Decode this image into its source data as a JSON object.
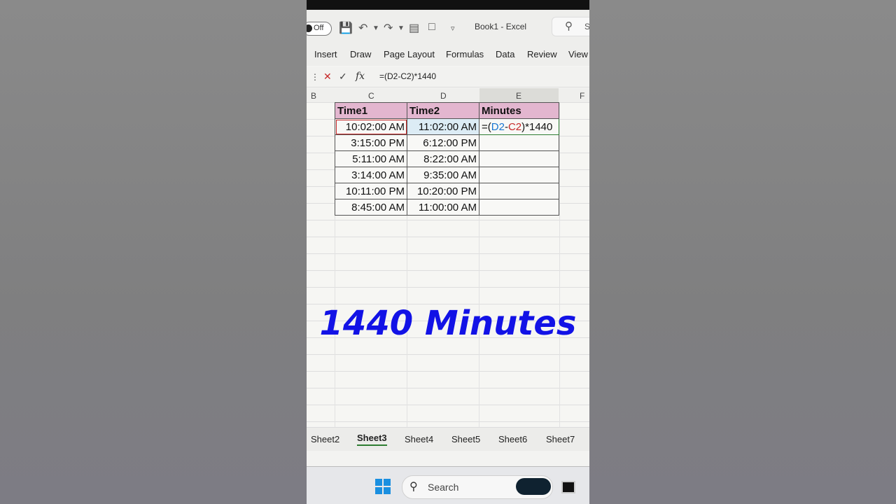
{
  "window": {
    "title": "Book1  -  Excel",
    "autosave_label": "Off",
    "search_label": "S"
  },
  "ribbon": {
    "tabs": [
      "Insert",
      "Draw",
      "Page Layout",
      "Formulas",
      "Data",
      "Review",
      "View"
    ]
  },
  "formula_bar": {
    "fx": "fx",
    "formula": "=(D2-C2)*1440"
  },
  "columns": [
    "B",
    "C",
    "D",
    "E",
    "F"
  ],
  "table": {
    "headers": [
      "Time1",
      "Time2",
      "Minutes"
    ],
    "rows": [
      [
        "10:02:00 AM",
        "11:02:00 AM",
        ""
      ],
      [
        "3:15:00 PM",
        "6:12:00 PM",
        ""
      ],
      [
        "5:11:00 AM",
        "8:22:00 AM",
        ""
      ],
      [
        "3:14:00 AM",
        "9:35:00 AM",
        ""
      ],
      [
        "10:11:00 PM",
        "10:20:00 PM",
        ""
      ],
      [
        "8:45:00 AM",
        "11:00:00 AM",
        ""
      ]
    ],
    "active_cell": {
      "prefix": "=(",
      "ref1": "D2",
      "sep": "-",
      "ref2": "C2",
      "suffix": ")*1440"
    }
  },
  "overlay_text": "1440 Minutes",
  "sheets": {
    "tabs": [
      "Sheet2",
      "Sheet3",
      "Sheet4",
      "Sheet5",
      "Sheet6",
      "Sheet7"
    ],
    "active": "Sheet3"
  },
  "taskbar": {
    "search_label": "Search"
  },
  "colors": {
    "header_fill": "#e3b6cf",
    "overlay_text": "#1212e6",
    "ref_d": "#1976d2",
    "ref_c": "#c62828",
    "accent_green": "#2e7d32"
  }
}
